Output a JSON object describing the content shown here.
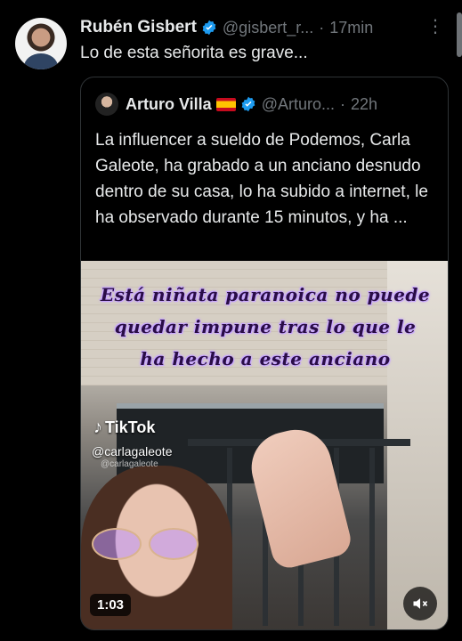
{
  "tweet": {
    "author_name": "Rubén Gisbert",
    "author_handle": "@gisbert_r...",
    "separator": "·",
    "time": "17min",
    "more": "⋮",
    "text": "Lo de esta señorita es grave..."
  },
  "quote": {
    "author_name": "Arturo Villa",
    "author_handle": "@Arturo...",
    "separator": "·",
    "time": "22h",
    "text": "La influencer a sueldo de Podemos, Carla Galeote, ha grabado a un anciano desnudo dentro de su casa, lo ha subido a internet, le ha observado durante 15 minutos, y ha ..."
  },
  "video": {
    "overlay_lines": [
      "Está niñata paranoica no puede",
      "quedar impune tras lo que le",
      "ha hecho a este anciano"
    ],
    "tiktok_label": "TikTok",
    "tiktok_user": "@carlagaleote",
    "tiktok_user_faint": "@carlagaleote",
    "duration": "1:03"
  },
  "colors": {
    "background": "#000000",
    "text": "#e7e9ea",
    "muted": "#71767b",
    "verified": "#1d9bf0",
    "overlay": "#2a0d47"
  },
  "icons": [
    "verified-icon",
    "more-icon",
    "mute-icon",
    "tiktok-note-icon"
  ]
}
